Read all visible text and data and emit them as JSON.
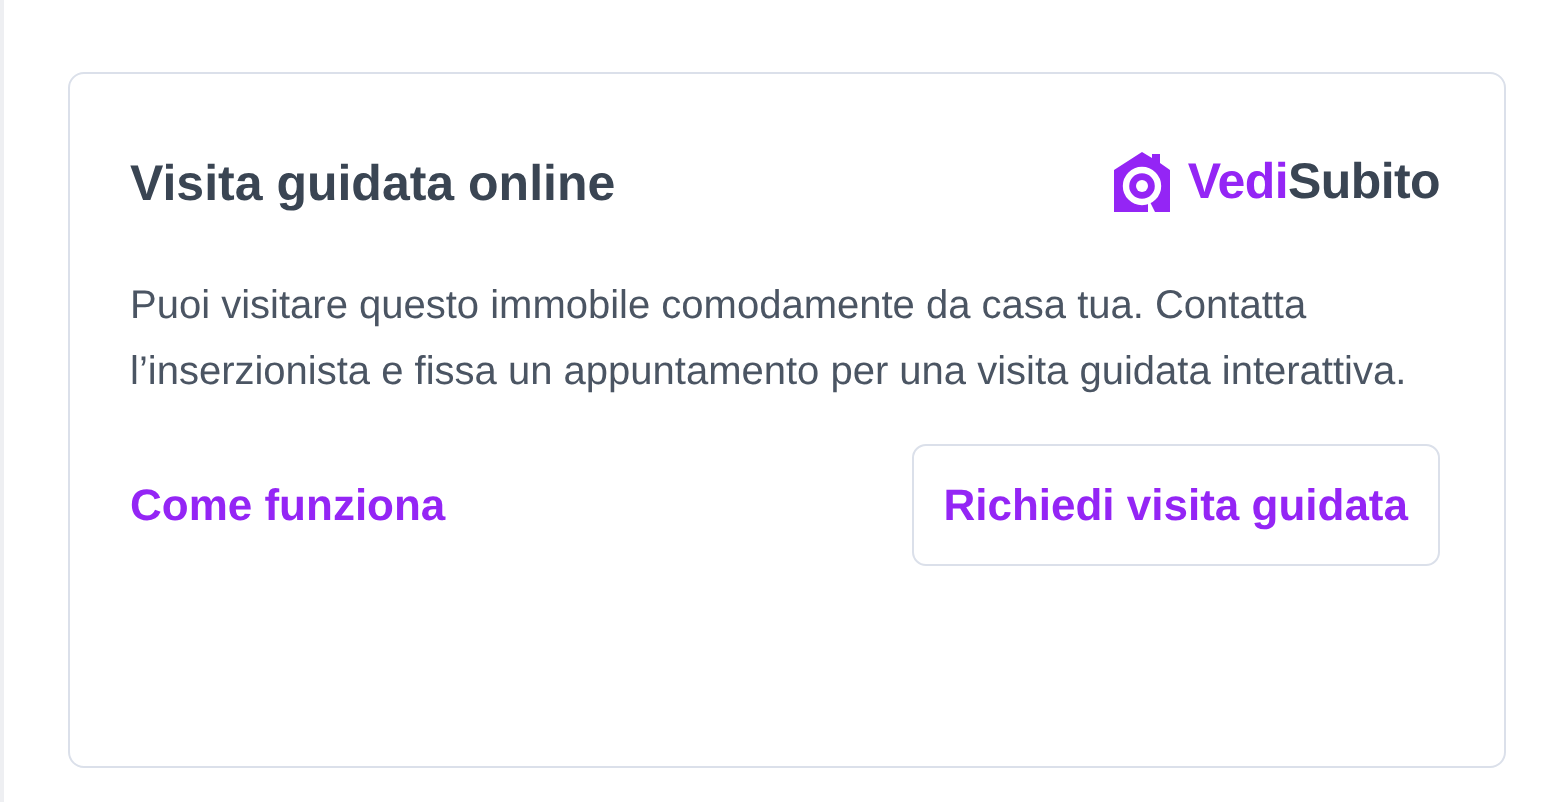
{
  "card": {
    "title": "Visita guidata online",
    "logo": {
      "primary": "Vedi",
      "secondary": "Subito"
    },
    "description": "Puoi visitare questo immobile comodamente da casa tua. Contatta l’inserzionista e fissa un appuntamento per una visita guidata interattiva.",
    "link": "Come funziona",
    "button": "Richiedi visita guidata"
  }
}
